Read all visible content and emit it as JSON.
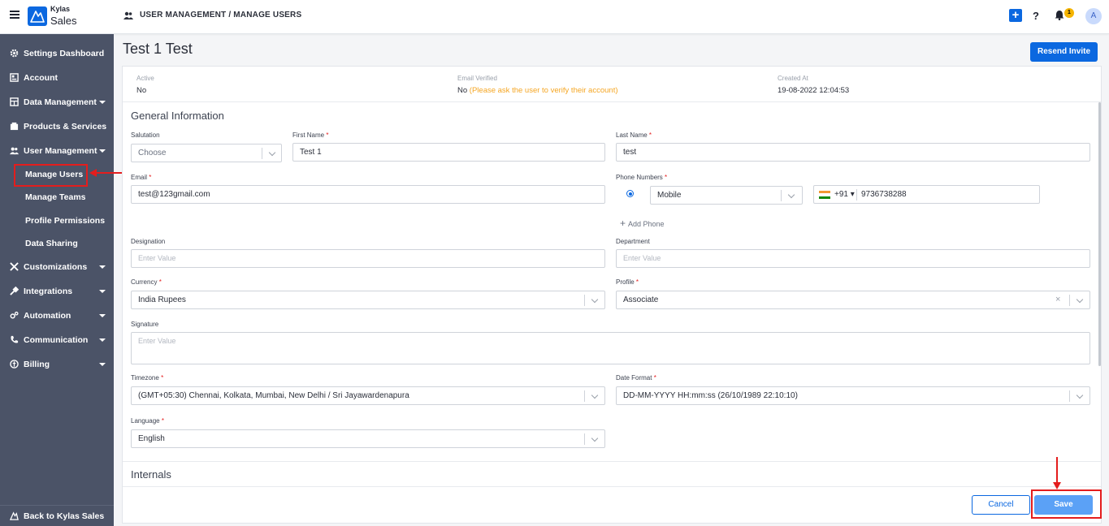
{
  "app": {
    "brand_top": "Kylas",
    "brand_bottom": "Sales"
  },
  "header": {
    "breadcrumb": "USER MANAGEMENT / MANAGE USERS",
    "help": "?",
    "notification_count": "1",
    "avatar_initial": "A"
  },
  "sidebar": {
    "items": [
      {
        "label": "Settings Dashboard"
      },
      {
        "label": "Account"
      },
      {
        "label": "Data Management"
      },
      {
        "label": "Products & Services"
      },
      {
        "label": "User Management"
      },
      {
        "label": "Customizations"
      },
      {
        "label": "Integrations"
      },
      {
        "label": "Automation"
      },
      {
        "label": "Communication"
      },
      {
        "label": "Billing"
      }
    ],
    "sub_items": [
      {
        "label": "Manage Users"
      },
      {
        "label": "Manage Teams"
      },
      {
        "label": "Profile Permissions"
      },
      {
        "label": "Data Sharing"
      }
    ],
    "back_label": "Back to Kylas Sales"
  },
  "page": {
    "title": "Test 1 Test",
    "resend_label": "Resend Invite"
  },
  "info": {
    "active_label": "Active",
    "active_value": "No",
    "email_verified_label": "Email Verified",
    "email_verified_value": "No",
    "email_verified_note": "(Please ask the user to verify their account)",
    "created_label": "Created At",
    "created_value": "19-08-2022 12:04:53"
  },
  "form": {
    "section_general": "General Information",
    "salutation_label": "Salutation",
    "salutation_value": "Choose",
    "first_name_label": "First Name",
    "first_name_value": "Test 1",
    "last_name_label": "Last Name",
    "last_name_value": "test",
    "email_label": "Email",
    "email_value": "test@123gmail.com",
    "phone_label": "Phone Numbers",
    "phone_type": "Mobile",
    "phone_code": "+91",
    "phone_number": "9736738288",
    "add_phone": "Add Phone",
    "designation_label": "Designation",
    "designation_placeholder": "Enter Value",
    "department_label": "Department",
    "department_placeholder": "Enter Value",
    "currency_label": "Currency",
    "currency_value": "India Rupees",
    "profile_label": "Profile",
    "profile_value": "Associate",
    "signature_label": "Signature",
    "signature_placeholder": "Enter Value",
    "timezone_label": "Timezone",
    "timezone_value": "(GMT+05:30) Chennai, Kolkata, Mumbai, New Delhi / Sri Jayawardenapura",
    "date_format_label": "Date Format",
    "date_format_value": "DD-MM-YYYY HH:mm:ss (26/10/1989 22:10:10)",
    "language_label": "Language",
    "language_value": "English",
    "required_mark": "*",
    "section_internals": "Internals"
  },
  "footer": {
    "cancel_label": "Cancel",
    "save_label": "Save"
  },
  "colors": {
    "primary": "#0b68e0",
    "sidebar": "#4b5367",
    "annotation": "#e41d1d",
    "warning": "#f5a623"
  }
}
